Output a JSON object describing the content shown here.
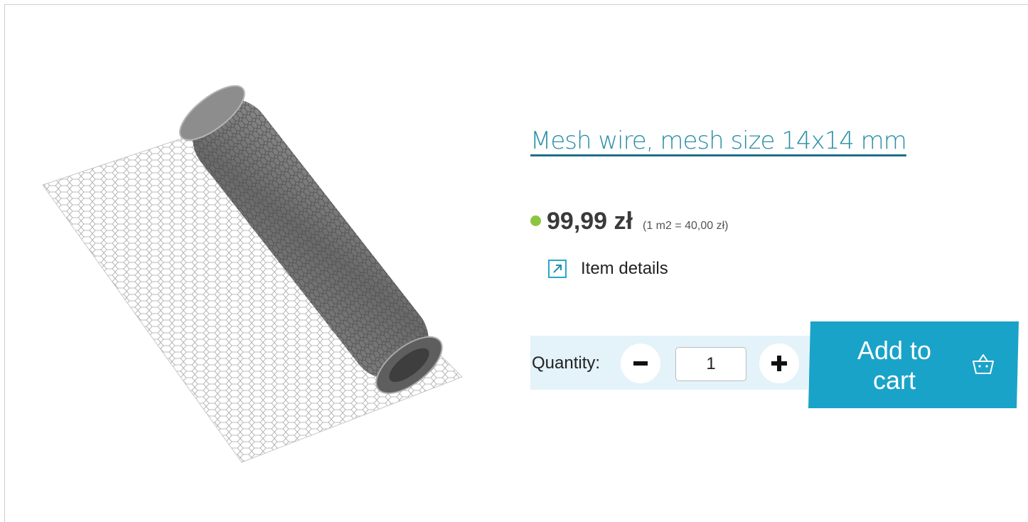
{
  "product": {
    "title": "Mesh wire, mesh size 14x14 mm",
    "image_alt": "Roll of galvanized hexagonal mesh wire",
    "price": "99,99 zł",
    "unit_price": "(1 m2 = 40,00 zł)",
    "stock_color": "#8cc63f",
    "details_label": "Item details",
    "details_icon": "external-link-icon"
  },
  "cart": {
    "quantity_label": "Quantity:",
    "quantity_value": "1",
    "minus_icon": "minus-icon",
    "plus_icon": "plus-icon",
    "add_to_cart_label": "Add to cart",
    "cart_icon": "basket-icon",
    "accent_color": "#1aa3c8"
  }
}
